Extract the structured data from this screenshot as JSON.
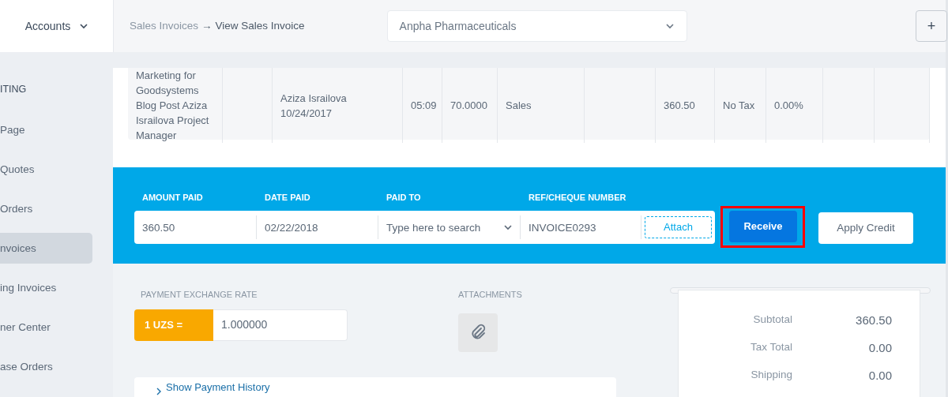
{
  "sidebar": {
    "menu_title": "Accounts",
    "section_label": "ITING",
    "items": [
      {
        "label": "Page",
        "selected": false
      },
      {
        "label": "Quotes",
        "selected": false
      },
      {
        "label": "Orders",
        "selected": false
      },
      {
        "label": "nvoices",
        "selected": true
      },
      {
        "label": "ing Invoices",
        "selected": false
      },
      {
        "label": "ner Center",
        "selected": false
      },
      {
        "label": "ase Orders",
        "selected": false
      }
    ]
  },
  "header": {
    "breadcrumb": [
      "Sales Invoices",
      "View Sales Invoice"
    ],
    "breadcrumb_separator": "→",
    "company": "Anpha Pharmaceuticals",
    "add_button": "+"
  },
  "line_items": {
    "rows": [
      {
        "cells": [
          "Marketing for Goodsystems Blog Post Aziza Israilova Project Manager",
          "",
          "Aziza Israilova 10/24/2017",
          "05:09",
          "70.0000",
          "Sales",
          "",
          "360.50",
          "No Tax",
          "0.00%",
          "",
          ""
        ]
      }
    ]
  },
  "payment": {
    "fields": [
      {
        "label": "AMOUNT PAID",
        "kind": "text",
        "value": "360.50"
      },
      {
        "label": "DATE PAID",
        "kind": "text",
        "value": "02/22/2018"
      },
      {
        "label": "PAID TO",
        "kind": "select",
        "placeholder": "Type here to search"
      },
      {
        "label": "REF/CHEQUE NUMBER",
        "kind": "text",
        "value": "INVOICE0293"
      }
    ],
    "attach_button": "Attach",
    "receive_button": {
      "label": "Receive",
      "highlighted": true
    },
    "apply_credit_button": "Apply Credit"
  },
  "exchange_rate": {
    "label": "PAYMENT EXCHANGE RATE",
    "currency": "1 UZS =",
    "value": "1.000000"
  },
  "attachments": {
    "label": "ATTACHMENTS"
  },
  "totals": [
    {
      "label": "Subtotal",
      "value": "360.50"
    },
    {
      "label": "Tax Total",
      "value": "0.00"
    },
    {
      "label": "Shipping",
      "value": "0.00"
    }
  ],
  "payment_history": {
    "label": "Show Payment History"
  }
}
